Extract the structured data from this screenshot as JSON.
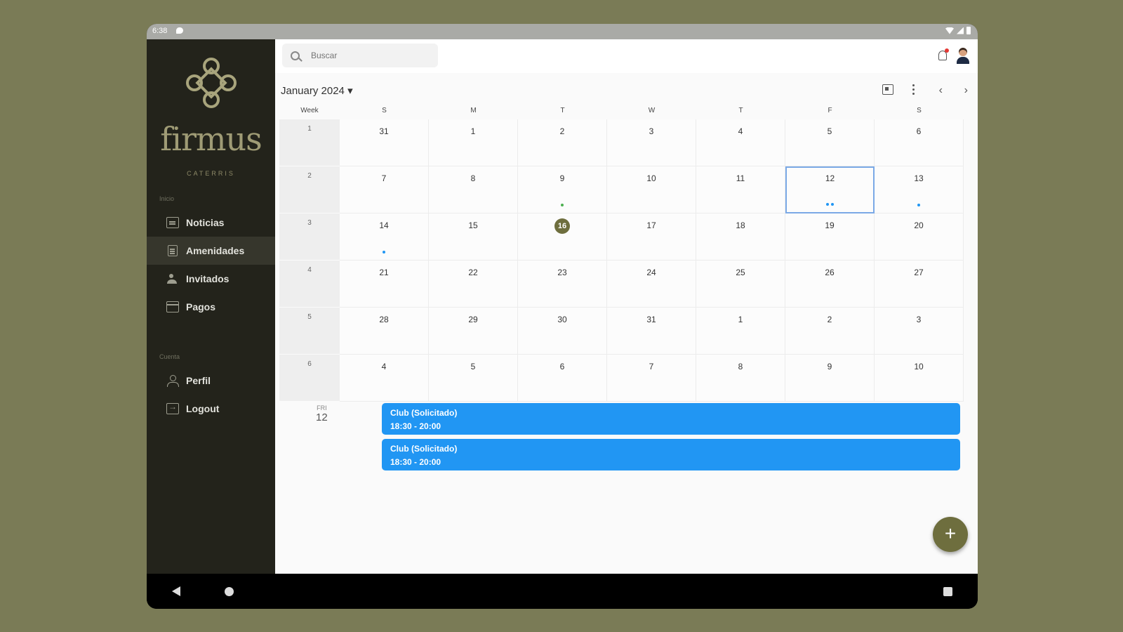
{
  "status_bar": {
    "time": "6:38"
  },
  "sidebar": {
    "brand": "firmus",
    "brand_sub": "CATERRIS",
    "section_main": "Inicio",
    "items": [
      {
        "label": "Noticias",
        "icon": "news-icon"
      },
      {
        "label": "Amenidades",
        "icon": "document-icon"
      },
      {
        "label": "Invitados",
        "icon": "people-icon"
      },
      {
        "label": "Pagos",
        "icon": "card-icon"
      }
    ],
    "section_account": "Cuenta",
    "account_items": [
      {
        "label": "Perfil",
        "icon": "person-icon"
      },
      {
        "label": "Logout",
        "icon": "logout-icon"
      }
    ],
    "active_item": "Amenidades"
  },
  "search": {
    "placeholder": "Buscar"
  },
  "calendar": {
    "title": "January 2024 ▾",
    "week_header": "Week",
    "day_headers": [
      "S",
      "M",
      "T",
      "W",
      "T",
      "F",
      "S"
    ],
    "weeks": [
      {
        "week": "1",
        "days": [
          "31",
          "1",
          "2",
          "3",
          "4",
          "5",
          "6"
        ]
      },
      {
        "week": "2",
        "days": [
          "7",
          "8",
          "9",
          "10",
          "11",
          "12",
          "13"
        ]
      },
      {
        "week": "3",
        "days": [
          "14",
          "15",
          "16",
          "17",
          "18",
          "19",
          "20"
        ]
      },
      {
        "week": "4",
        "days": [
          "21",
          "22",
          "23",
          "24",
          "25",
          "26",
          "27"
        ]
      },
      {
        "week": "5",
        "days": [
          "28",
          "29",
          "30",
          "31",
          "1",
          "2",
          "3"
        ]
      },
      {
        "week": "6",
        "days": [
          "4",
          "5",
          "6",
          "7",
          "8",
          "9",
          "10"
        ]
      }
    ],
    "today": "16",
    "selected": "12",
    "colors": {
      "today": "#6e6e3e",
      "selected_border": "#7ba9e6",
      "event": "#2196f3",
      "mark_green": "#4caf50"
    }
  },
  "agenda": {
    "day_of_week": "FRI",
    "day_number": "12",
    "events": [
      {
        "title": "Club (Solicitado)",
        "time": "18:30 - 20:00"
      },
      {
        "title": "Club (Solicitado)",
        "time": "18:30 - 20:00"
      }
    ]
  },
  "fab": {
    "label": "+"
  }
}
